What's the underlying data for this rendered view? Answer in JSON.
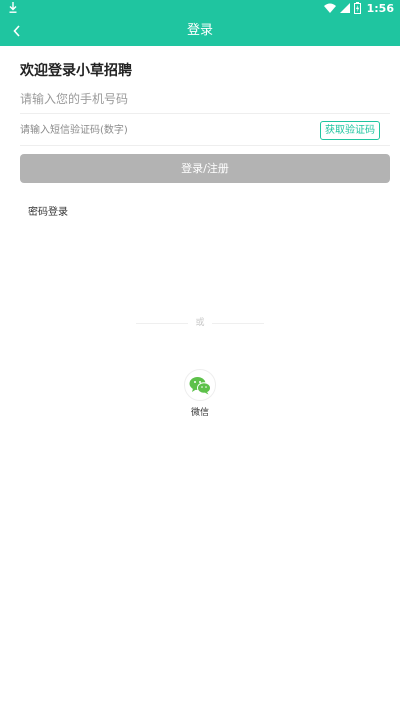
{
  "status_bar": {
    "time": "1:56",
    "icons": [
      "download-icon",
      "wifi-icon",
      "signal-icon",
      "battery-icon"
    ]
  },
  "header": {
    "title": "登录",
    "back_icon": "chevron-left-icon"
  },
  "form": {
    "welcome": "欢迎登录小草招聘",
    "phone_placeholder": "请输入您的手机号码",
    "code_placeholder": "请输入短信验证码(数字)",
    "get_code_label": "获取验证码",
    "submit_label": "登录/注册",
    "password_login_label": "密码登录"
  },
  "social": {
    "divider_text": "或",
    "wechat_label": "微信",
    "wechat_icon": "wechat-icon"
  },
  "colors": {
    "primary": "#1fc5a0",
    "disabled_button": "#b3b3b3",
    "wechat_green": "#5dc14a"
  }
}
